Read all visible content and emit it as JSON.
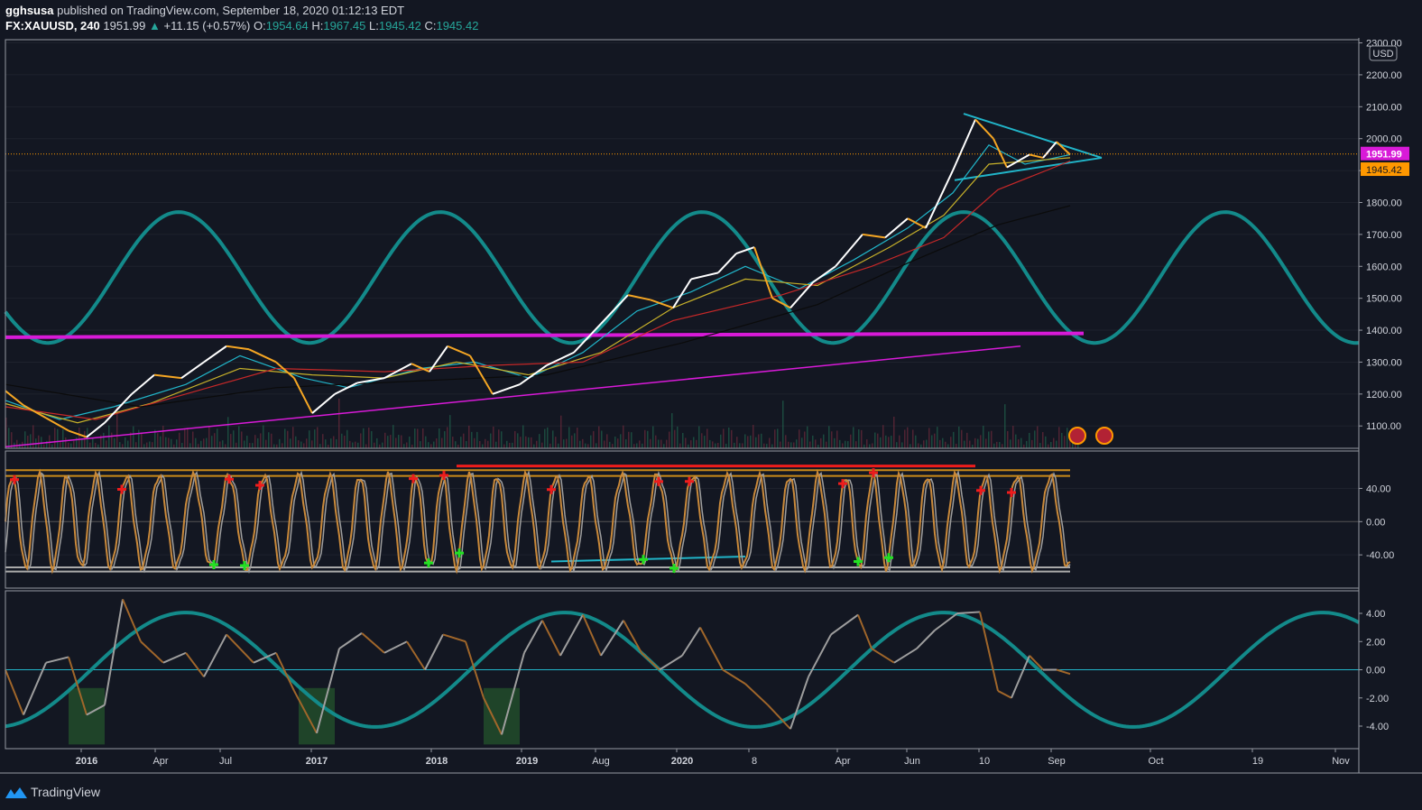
{
  "header": {
    "author": "gghsusa",
    "published_text": "published on TradingView.com, September 18, 2020 01:12:13 EDT",
    "symbol": "FX:XAUUSD, 240",
    "last_price": "1951.99",
    "change_arrow": "▲",
    "change": "+11.15 (+0.57%)",
    "open_label": "O:",
    "open": "1954.64",
    "high_label": "H:",
    "high": "1967.45",
    "low_label": "L:",
    "low": "1945.42",
    "close_label": "C:",
    "close": "1945.42"
  },
  "footer": {
    "brand": "TradingView",
    "logo_icon": "tradingview-logo-icon"
  },
  "colors": {
    "background": "#131722",
    "cycle": "#138a8a",
    "magenta": "#d81ad8",
    "price_up": "#ffffff",
    "price_down": "#f5a623",
    "ema_fast": "#21b5c9",
    "ema_mid": "#c7b12a",
    "ema_slow": "#c62828",
    "sma_long": "#0b0b0b",
    "stoch": "#c9893a",
    "buy_marker": "#22e022",
    "sell_marker": "#ee1c1c",
    "last_price_tag": "#d81ad8",
    "low_price_tag": "#ff9800"
  },
  "chart_data": [
    {
      "type": "line",
      "pane": "price",
      "currency": "USD",
      "ylim": [
        1030,
        2310
      ],
      "y_ticks": [
        1100,
        1200,
        1300,
        1400,
        1500,
        1600,
        1700,
        1800,
        1900,
        2000,
        2100,
        2200,
        2300
      ],
      "y_tick_labels": [
        "1100.00",
        "1200.00",
        "1300.00",
        "1400.00",
        "1500.00",
        "1600.00",
        "1700.00",
        "1800.00",
        "1900.00",
        "2000.00",
        "2100.00",
        "2200.00",
        "2300.00"
      ],
      "x_tick_labels": [
        "2016",
        "Apr",
        "Jul",
        "2017",
        "2018",
        "2019",
        "Aug",
        "2020",
        "8",
        "Apr",
        "Jun",
        "10",
        "Sep",
        "Oct",
        "19",
        "Nov"
      ],
      "last_price_label": "1951.99",
      "low_price_label": "1945.42",
      "series": [
        {
          "values": [
            [
              0,
              1210
            ],
            [
              20,
              1165
            ],
            [
              45,
              1125
            ],
            [
              70,
              1085
            ],
            [
              90,
              1065
            ],
            [
              110,
              1110
            ],
            [
              140,
              1200
            ],
            [
              165,
              1260
            ],
            [
              195,
              1250
            ],
            [
              220,
              1300
            ],
            [
              245,
              1350
            ],
            [
              270,
              1340
            ],
            [
              300,
              1300
            ],
            [
              320,
              1250
            ],
            [
              340,
              1140
            ],
            [
              365,
              1200
            ],
            [
              390,
              1235
            ],
            [
              420,
              1250
            ],
            [
              450,
              1295
            ],
            [
              470,
              1270
            ],
            [
              490,
              1350
            ],
            [
              515,
              1320
            ],
            [
              540,
              1200
            ],
            [
              570,
              1230
            ],
            [
              600,
              1290
            ],
            [
              630,
              1330
            ],
            [
              660,
              1420
            ],
            [
              690,
              1510
            ],
            [
              715,
              1495
            ],
            [
              740,
              1470
            ],
            [
              760,
              1560
            ],
            [
              790,
              1580
            ],
            [
              810,
              1640
            ],
            [
              830,
              1660
            ],
            [
              850,
              1500
            ],
            [
              870,
              1470
            ],
            [
              895,
              1550
            ],
            [
              920,
              1600
            ],
            [
              950,
              1700
            ],
            [
              975,
              1690
            ],
            [
              1000,
              1750
            ],
            [
              1020,
              1720
            ],
            [
              1050,
              1900
            ],
            [
              1075,
              2060
            ],
            [
              1095,
              2000
            ],
            [
              1110,
              1910
            ],
            [
              1135,
              1950
            ],
            [
              1150,
              1940
            ],
            [
              1165,
              1990
            ],
            [
              1180,
              1950
            ]
          ]
        },
        {
          "values": [
            [
              0,
              1180
            ],
            [
              60,
              1120
            ],
            [
              120,
              1160
            ],
            [
              200,
              1230
            ],
            [
              260,
              1320
            ],
            [
              330,
              1250
            ],
            [
              380,
              1220
            ],
            [
              460,
              1280
            ],
            [
              520,
              1300
            ],
            [
              580,
              1250
            ],
            [
              640,
              1330
            ],
            [
              700,
              1460
            ],
            [
              760,
              1520
            ],
            [
              820,
              1600
            ],
            [
              880,
              1530
            ],
            [
              940,
              1620
            ],
            [
              1000,
              1720
            ],
            [
              1050,
              1830
            ],
            [
              1090,
              1980
            ],
            [
              1130,
              1920
            ],
            [
              1180,
              1950
            ]
          ]
        },
        {
          "values": [
            [
              0,
              1170
            ],
            [
              80,
              1110
            ],
            [
              160,
              1170
            ],
            [
              260,
              1280
            ],
            [
              340,
              1260
            ],
            [
              420,
              1250
            ],
            [
              500,
              1300
            ],
            [
              580,
              1260
            ],
            [
              660,
              1330
            ],
            [
              740,
              1470
            ],
            [
              820,
              1560
            ],
            [
              900,
              1540
            ],
            [
              980,
              1660
            ],
            [
              1040,
              1760
            ],
            [
              1090,
              1920
            ],
            [
              1180,
              1940
            ]
          ]
        },
        {
          "values": [
            [
              0,
              1160
            ],
            [
              100,
              1120
            ],
            [
              200,
              1200
            ],
            [
              300,
              1280
            ],
            [
              420,
              1270
            ],
            [
              540,
              1290
            ],
            [
              640,
              1300
            ],
            [
              740,
              1430
            ],
            [
              860,
              1510
            ],
            [
              960,
              1600
            ],
            [
              1040,
              1690
            ],
            [
              1100,
              1840
            ],
            [
              1180,
              1930
            ]
          ]
        },
        {
          "values": [
            [
              0,
              1230
            ],
            [
              150,
              1160
            ],
            [
              300,
              1220
            ],
            [
              450,
              1240
            ],
            [
              600,
              1260
            ],
            [
              750,
              1360
            ],
            [
              900,
              1480
            ],
            [
              1000,
              1610
            ],
            [
              1100,
              1730
            ],
            [
              1180,
              1790
            ]
          ]
        }
      ],
      "trendlines": [
        {
          "from": [
            0,
            1378
          ],
          "to": [
            1195,
            1390
          ],
          "width": 4
        },
        {
          "from": [
            0,
            1035
          ],
          "to": [
            1125,
            1350
          ],
          "width": 1.5
        },
        {
          "from": [
            1062,
            2078
          ],
          "to": [
            1215,
            1940
          ],
          "width": 2
        },
        {
          "from": [
            1052,
            1870
          ],
          "to": [
            1215,
            1940
          ],
          "width": 2
        }
      ],
      "cycle": {
        "amplitude": 1,
        "period_bars": 290,
        "first_peak_bar": 192,
        "center": 1565,
        "half_range": 205
      }
    },
    {
      "type": "line",
      "pane": "stochastic",
      "ylim": [
        -80,
        85
      ],
      "y_ticks": [
        -40,
        0,
        40
      ],
      "y_tick_labels": [
        "-40.00",
        "0.00",
        "40.00"
      ],
      "levels": [
        55,
        62,
        -55,
        -60
      ],
      "red_resistance": {
        "from": [
          500,
          67
        ],
        "to": [
          1075,
          67
        ]
      },
      "cyan_support": {
        "from": [
          605,
          -48
        ],
        "to": [
          820,
          -42
        ]
      },
      "oscillation": {
        "period_bars": 34,
        "amplitude": 55
      }
    },
    {
      "type": "line",
      "pane": "cycle_oscillator",
      "ylim": [
        -5.6,
        5.6
      ],
      "y_ticks": [
        -4,
        -2,
        0,
        2,
        4
      ],
      "y_tick_labels": [
        "-4.00",
        "-2.00",
        "0.00",
        "2.00",
        "4.00"
      ],
      "cycle": {
        "amplitude": 2.9,
        "period_bars": 420,
        "first_peak_bar": 200
      },
      "oscillator": {
        "values": [
          [
            0,
            0
          ],
          [
            20,
            -3.2
          ],
          [
            45,
            0.5
          ],
          [
            70,
            0.9
          ],
          [
            90,
            -3.2
          ],
          [
            110,
            -2.5
          ],
          [
            130,
            5.0
          ],
          [
            150,
            2.0
          ],
          [
            175,
            0.5
          ],
          [
            200,
            1.2
          ],
          [
            220,
            -0.5
          ],
          [
            245,
            2.5
          ],
          [
            275,
            0.5
          ],
          [
            300,
            1.2
          ],
          [
            320,
            -1.5
          ],
          [
            345,
            -4.5
          ],
          [
            370,
            1.5
          ],
          [
            395,
            2.6
          ],
          [
            420,
            1.2
          ],
          [
            445,
            2.0
          ],
          [
            465,
            0.0
          ],
          [
            485,
            2.5
          ],
          [
            510,
            2.0
          ],
          [
            530,
            -2.0
          ],
          [
            550,
            -4.6
          ],
          [
            575,
            1.2
          ],
          [
            595,
            3.5
          ],
          [
            615,
            1.0
          ],
          [
            640,
            3.9
          ],
          [
            660,
            1.0
          ],
          [
            685,
            3.5
          ],
          [
            705,
            1.2
          ],
          [
            725,
            0.0
          ],
          [
            750,
            1.0
          ],
          [
            770,
            3.0
          ],
          [
            795,
            0.0
          ],
          [
            820,
            -1.0
          ],
          [
            845,
            -2.5
          ],
          [
            870,
            -4.2
          ],
          [
            890,
            -0.5
          ],
          [
            915,
            2.5
          ],
          [
            945,
            3.9
          ],
          [
            960,
            1.5
          ],
          [
            985,
            0.5
          ],
          [
            1010,
            1.5
          ],
          [
            1030,
            2.8
          ],
          [
            1055,
            4.0
          ],
          [
            1080,
            4.1
          ],
          [
            1100,
            -1.5
          ],
          [
            1115,
            -2.0
          ],
          [
            1135,
            1.0
          ],
          [
            1150,
            0.0
          ],
          [
            1165,
            0.0
          ],
          [
            1180,
            -0.3
          ]
        ]
      }
    }
  ]
}
